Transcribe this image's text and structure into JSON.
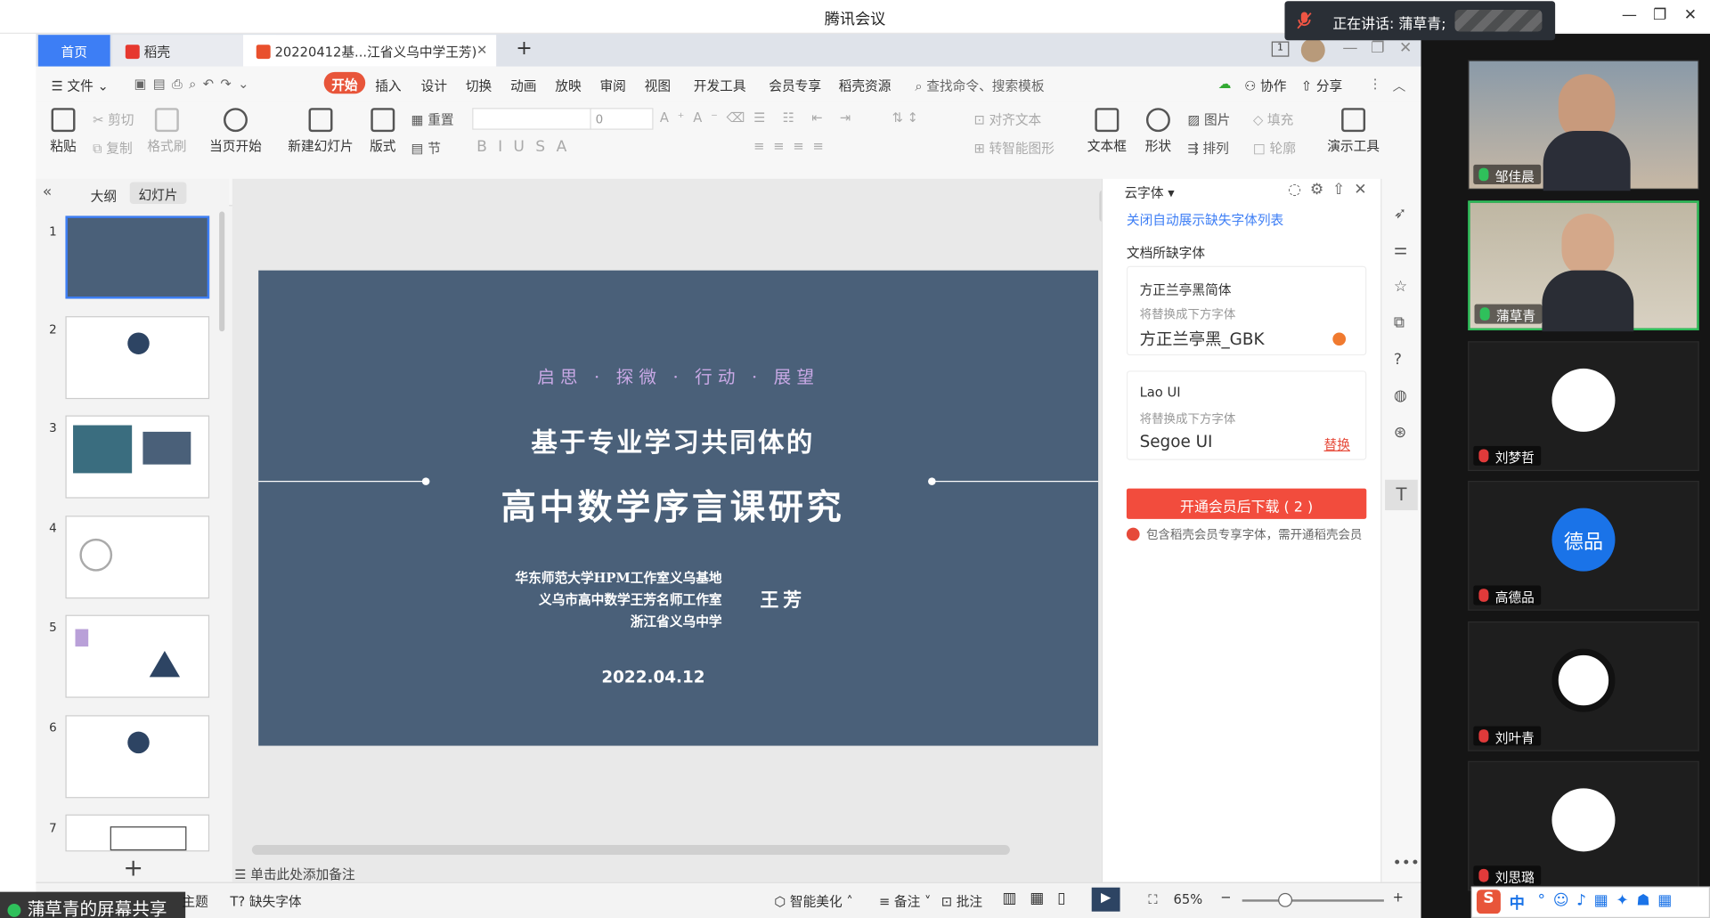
{
  "meeting": {
    "title": "腾讯会议",
    "speaking": "正在讲话: 蒲草青;"
  },
  "wps": {
    "tabs": {
      "home": "首页",
      "daoke": "稻壳",
      "doc": "20220412基...江省义乌中学王芳)"
    },
    "menu": [
      "文件",
      "开始",
      "插入",
      "设计",
      "切换",
      "动画",
      "放映",
      "审阅",
      "视图",
      "开发工具",
      "会员专享",
      "稻壳资源"
    ],
    "search": "查找命令、搜索模板",
    "collab": "协作",
    "share": "分享",
    "ribbon": {
      "paste": "粘贴",
      "cut": "剪切",
      "copy": "复制",
      "format_painter": "格式刷",
      "play_from_current": "当页开始",
      "new_slide": "新建幻灯片",
      "layout": "版式",
      "reset": "重置",
      "section": "节",
      "font_size": "0",
      "align_text": "对齐文本",
      "smart_shape": "转智能图形",
      "textbox": "文本框",
      "shape": "形状",
      "picture": "图片",
      "arrange": "排列",
      "fill": "填充",
      "outline": "轮廓",
      "present_tools": "演示工具"
    },
    "left": {
      "outline_tab": "大纲",
      "slides_tab": "幻灯片",
      "slides": [
        "1",
        "2",
        "3",
        "4",
        "5",
        "6",
        "7"
      ]
    },
    "slide": {
      "motto": "启思 · 探微 · 行动 · 展望",
      "title1": "基于专业学习共同体的",
      "title2": "高中数学序言课研究",
      "org1": "华东师范大学HPM工作室义乌基地",
      "org2": "义乌市高中数学王芳名师工作室",
      "org3": "浙江省义乌中学",
      "author": "王芳",
      "date": "2022.04.12"
    },
    "notes": "单击此处添加备注",
    "cloud_font": {
      "header": "云字体",
      "toggle_link": "关闭自动展示缺失字体列表",
      "missing_title": "文档所缺字体",
      "font1": {
        "name": "方正兰亭黑简体",
        "hint": "将替换成下方字体",
        "replacement": "方正兰亭黑_GBK"
      },
      "font2": {
        "name": "Lao UI",
        "hint": "将替换成下方字体",
        "replacement": "Segoe UI",
        "action": "替换"
      },
      "download_btn": "开通会员后下载 ( 2 )",
      "member_note": "包含稻壳会员专享字体，需开通稻壳会员"
    },
    "status": {
      "theme": "主题",
      "missing_font": "缺失字体",
      "beautify": "智能美化",
      "notes": "备注",
      "comment": "批注",
      "zoom": "65%"
    }
  },
  "participants": [
    {
      "name": "邹佳晨",
      "mic": "on",
      "video": true
    },
    {
      "name": "蒲草青",
      "mic": "on",
      "video": true,
      "speaking": true
    },
    {
      "name": "刘梦哲",
      "mic": "off"
    },
    {
      "name": "高德品",
      "mic": "off",
      "avatar_text": "德品"
    },
    {
      "name": "刘叶青",
      "mic": "off"
    },
    {
      "name": "刘思璐",
      "mic": "off"
    }
  ],
  "share_label": "蒲草青的屏幕共享",
  "ime": {
    "lang": "中"
  },
  "colors": {
    "accent": "#3d7ef5",
    "start_tab": "#e8553a",
    "slide_bg": "#4a6079",
    "download": "#f24c3d",
    "motto": "#c9a9e6"
  }
}
